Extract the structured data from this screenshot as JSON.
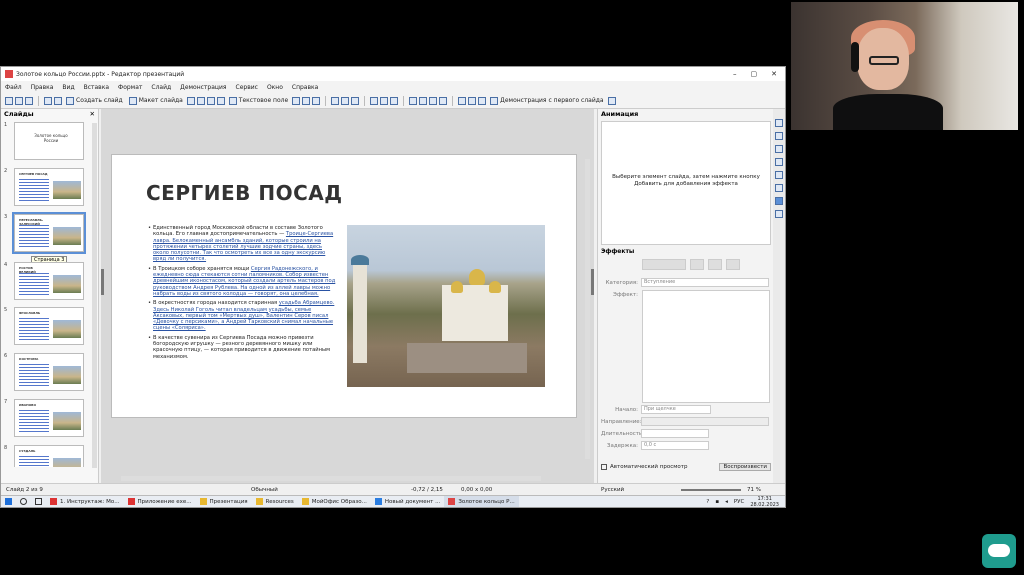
{
  "window": {
    "title": "Золотое кольцо России.pptx - Редактор презентаций",
    "controls": [
      "–",
      "▢",
      "✕"
    ]
  },
  "menu": [
    "Файл",
    "Правка",
    "Вид",
    "Вставка",
    "Формат",
    "Слайд",
    "Демонстрация",
    "Сервис",
    "Окно",
    "Справка"
  ],
  "toolbar": {
    "new_slide": "Создать слайд",
    "layout": "Макет слайда",
    "text_field": "Текстовое поле",
    "slideshow": "Демонстрация с первого слайда"
  },
  "slides_panel": {
    "header": "Слайды",
    "tooltip": "Страница 3",
    "thumbs": [
      {
        "num": "1",
        "title": "Золотое кольцо России"
      },
      {
        "num": "2",
        "title": "СЕРГИЕВ ПОСАД"
      },
      {
        "num": "3",
        "title": "ПЕРЕСЛАВЛЬ-ЗАЛЕССКИЙ"
      },
      {
        "num": "4",
        "title": "РОСТОВ ВЕЛИКИЙ"
      },
      {
        "num": "5",
        "title": "ЯРОСЛАВЛЬ"
      },
      {
        "num": "6",
        "title": "КОСТРОМА"
      },
      {
        "num": "7",
        "title": "ИВАНОВО"
      },
      {
        "num": "8",
        "title": "СУЗДАЛЬ"
      }
    ]
  },
  "slide": {
    "title": "СЕРГИЕВ ПОСАД",
    "bullets": [
      {
        "text": "Единственный город Московской области в составе Золотого кольца. Его главная достопримечательность —",
        "link": "Троице-Сергиева лавра. Белокаменный ансамбль зданий, которые строили на протяжении четырех столетий лучшие зодчие страны, здесь около полусотни. Так что осмотреть их все за одну экскурсию вряд ли получится."
      },
      {
        "text": "В Троицком соборе хранятся мощи",
        "link": "Сергия Радонежского, и ежедневно сюда стекаются сотни паломников. Собор известен древнейшим иконостасом, который создали артель мастеров под руководством Андрея Рублева. На одной из аллей лавры можно набрать воды из святого колодца — говорят, она целебная."
      },
      {
        "text": "В окрестностях города находится старинная",
        "link": "усадьба Абрамцево. Здесь Николай Гоголь читал владельцам усадьбы, семье Аксаковых, первый том «Мертвых душ», Валентин Серов писал «Девочку с персиками», а Андрей Тарковский снимал начальные сцены «Соляриса»."
      },
      {
        "text": "В качестве сувенира из Сергиева Посада можно привезти богородскую игрушку — резного деревянного мишку или красочную птицу, — которая приводится в движение потайным механизмом.",
        "link": ""
      }
    ]
  },
  "animation_panel": {
    "header": "Анимация",
    "hint_line1": "Выберите элемент слайда, затем нажмите кнопку",
    "hint_line2": "Добавить для добавления эффекта",
    "effects_label": "Эффекты",
    "category_label": "Категория:",
    "category_value": "Вступление",
    "effect_label": "Эффект:",
    "start_label": "Начало:",
    "start_value": "При щелчке",
    "direction_label": "Направление:",
    "duration_label": "Длительность:",
    "delay_label": "Задержка:",
    "delay_value": "0,0 с",
    "autopreview": "Автоматический просмотр",
    "play": "Воспроизвести"
  },
  "status": {
    "slide_of": "Слайд 2 из 9",
    "layout": "Обычный",
    "position": "-0,72 / 2,15",
    "size": "0,00 x 0,00",
    "lang": "Русский",
    "zoom": "71 %"
  },
  "taskbar": {
    "items": [
      "1. Инструктаж: Мо...",
      "Приложение еxе...",
      "Презентация",
      "Resources",
      "МойОфис Образо...",
      "Новый документ ...",
      "Золотое кольцо Р..."
    ],
    "lang": "РУС",
    "time": "17:31",
    "date": "28.02.2023"
  }
}
